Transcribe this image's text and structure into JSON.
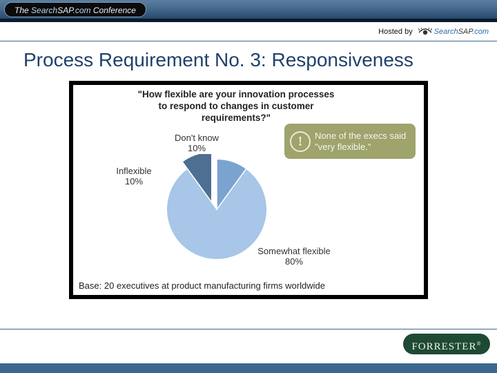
{
  "header": {
    "conference_prefix": "The",
    "conference_brand_a": "Search",
    "conference_brand_b": "SAP",
    "conference_brand_c": ".com",
    "conference_suffix": "Conference",
    "hosted_by_label": "Hosted by",
    "host_brand_a": "Search",
    "host_brand_b": "SAP",
    "host_brand_c": ".com"
  },
  "slide": {
    "title": "Process Requirement No. 3: Responsiveness"
  },
  "chart": {
    "question": "\"How flexible are your innovation processes to respond to changes in customer requirements?\"",
    "callout": "None of the execs said \"very flexible.\"",
    "labels": {
      "dont_know": "Don't know",
      "dont_know_pct": "10%",
      "inflexible": "Inflexible",
      "inflexible_pct": "10%",
      "somewhat": "Somewhat flexible",
      "somewhat_pct": "80%"
    },
    "base": "Base: 20 executives at product manufacturing firms worldwide"
  },
  "footer": {
    "forrester": "FORRESTER",
    "tm": "®"
  },
  "chart_data": {
    "type": "pie",
    "title": "How flexible are your innovation processes to respond to changes in customer requirements?",
    "categories": [
      "Somewhat flexible",
      "Don't know",
      "Inflexible"
    ],
    "values": [
      80,
      10,
      10
    ],
    "series": [
      {
        "name": "Somewhat flexible",
        "value": 80,
        "color": "#a7c6e8"
      },
      {
        "name": "Don't know",
        "value": 10,
        "color": "#7ba3cf"
      },
      {
        "name": "Inflexible",
        "value": 10,
        "color": "#4f6f92"
      }
    ],
    "annotations": [
      "None of the execs said \"very flexible.\""
    ],
    "base_n": 20,
    "base_text": "20 executives at product manufacturing firms worldwide"
  }
}
